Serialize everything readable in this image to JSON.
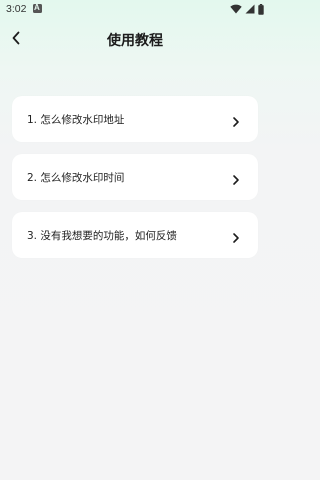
{
  "status_bar": {
    "time": "3:02",
    "icons": [
      "app-notification-icon",
      "wifi-icon",
      "signal-icon",
      "battery-icon"
    ]
  },
  "header": {
    "title": "使用教程",
    "back_icon": "chevron-left-icon"
  },
  "tutorials": [
    {
      "label": "1. 怎么修改水印地址",
      "icon": "chevron-right-icon"
    },
    {
      "label": "2. 怎么修改水印时间",
      "icon": "chevron-right-icon"
    },
    {
      "label": "3. 没有我想要的功能，如何反馈",
      "icon": "chevron-right-icon"
    }
  ],
  "colors": {
    "background_top": "#e3f8ee",
    "background": "#f4f4f5",
    "card": "#ffffff",
    "text": "#222222"
  }
}
